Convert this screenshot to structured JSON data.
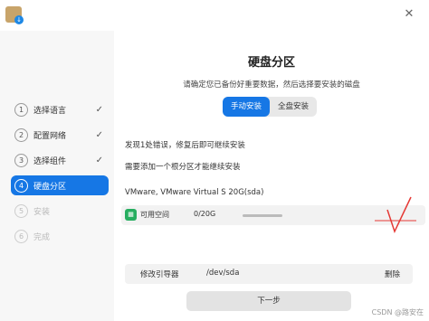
{
  "sidebar": {
    "steps": [
      {
        "num": "1",
        "label": "选择语言",
        "check": "✓"
      },
      {
        "num": "2",
        "label": "配置网络",
        "check": "✓"
      },
      {
        "num": "3",
        "label": "选择组件",
        "check": "✓"
      },
      {
        "num": "4",
        "label": "硬盘分区",
        "check": ""
      },
      {
        "num": "5",
        "label": "安装",
        "check": ""
      },
      {
        "num": "6",
        "label": "完成",
        "check": ""
      }
    ]
  },
  "main": {
    "title": "硬盘分区",
    "subtitle": "请确定您已备份好重要数据，然后选择要安装的磁盘",
    "tabs": [
      {
        "label": "手动安装",
        "active": true
      },
      {
        "label": "全盘安装",
        "active": false
      }
    ],
    "message1": "发现1处错误，修复后即可继续安装",
    "message2": "需要添加一个根分区才能继续安装",
    "disk_name": "VMware, VMware Virtual S 20G(sda)",
    "partition": {
      "label": "可用空间",
      "size": "0/20G"
    },
    "bootloader": {
      "label": "修改引导器",
      "value": "/dev/sda",
      "delete": "删除"
    },
    "next_button": "下一步"
  },
  "watermark": "CSDN @路安在",
  "colors": {
    "accent": "#1677e5",
    "annotation": "#e53935"
  }
}
